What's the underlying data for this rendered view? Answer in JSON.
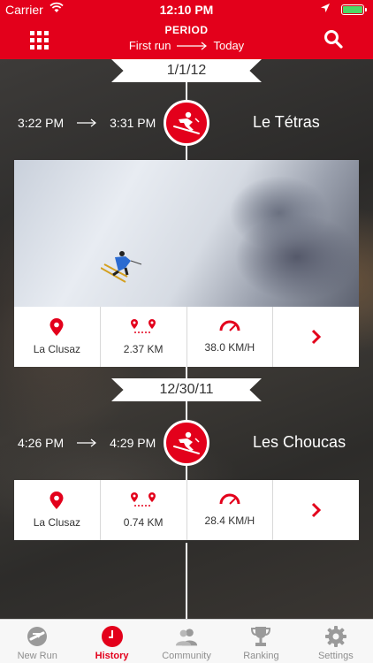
{
  "status_bar": {
    "carrier": "Carrier",
    "time": "12:10 PM"
  },
  "header": {
    "title": "PERIOD",
    "range_start": "First run",
    "range_end": "Today"
  },
  "runs": [
    {
      "date": "1/1/12",
      "start_time": "3:22 PM",
      "end_time": "3:31 PM",
      "run_name": "Le Tétras",
      "location": "La Clusaz",
      "distance": "2.37 KM",
      "speed": "38.0 KM/H"
    },
    {
      "date": "12/30/11",
      "start_time": "4:26 PM",
      "end_time": "4:29 PM",
      "run_name": "Les Choucas",
      "location": "La Clusaz",
      "distance": "0.74 KM",
      "speed": "28.4 KM/H"
    }
  ],
  "tabs": [
    {
      "label": "New Run",
      "icon": "rossignol-logo-icon"
    },
    {
      "label": "History",
      "icon": "clock-icon",
      "active": true
    },
    {
      "label": "Community",
      "icon": "community-icon"
    },
    {
      "label": "Ranking",
      "icon": "trophy-icon"
    },
    {
      "label": "Settings",
      "icon": "gear-icon"
    }
  ],
  "colors": {
    "accent": "#e3001b",
    "battery": "#4cd964"
  }
}
